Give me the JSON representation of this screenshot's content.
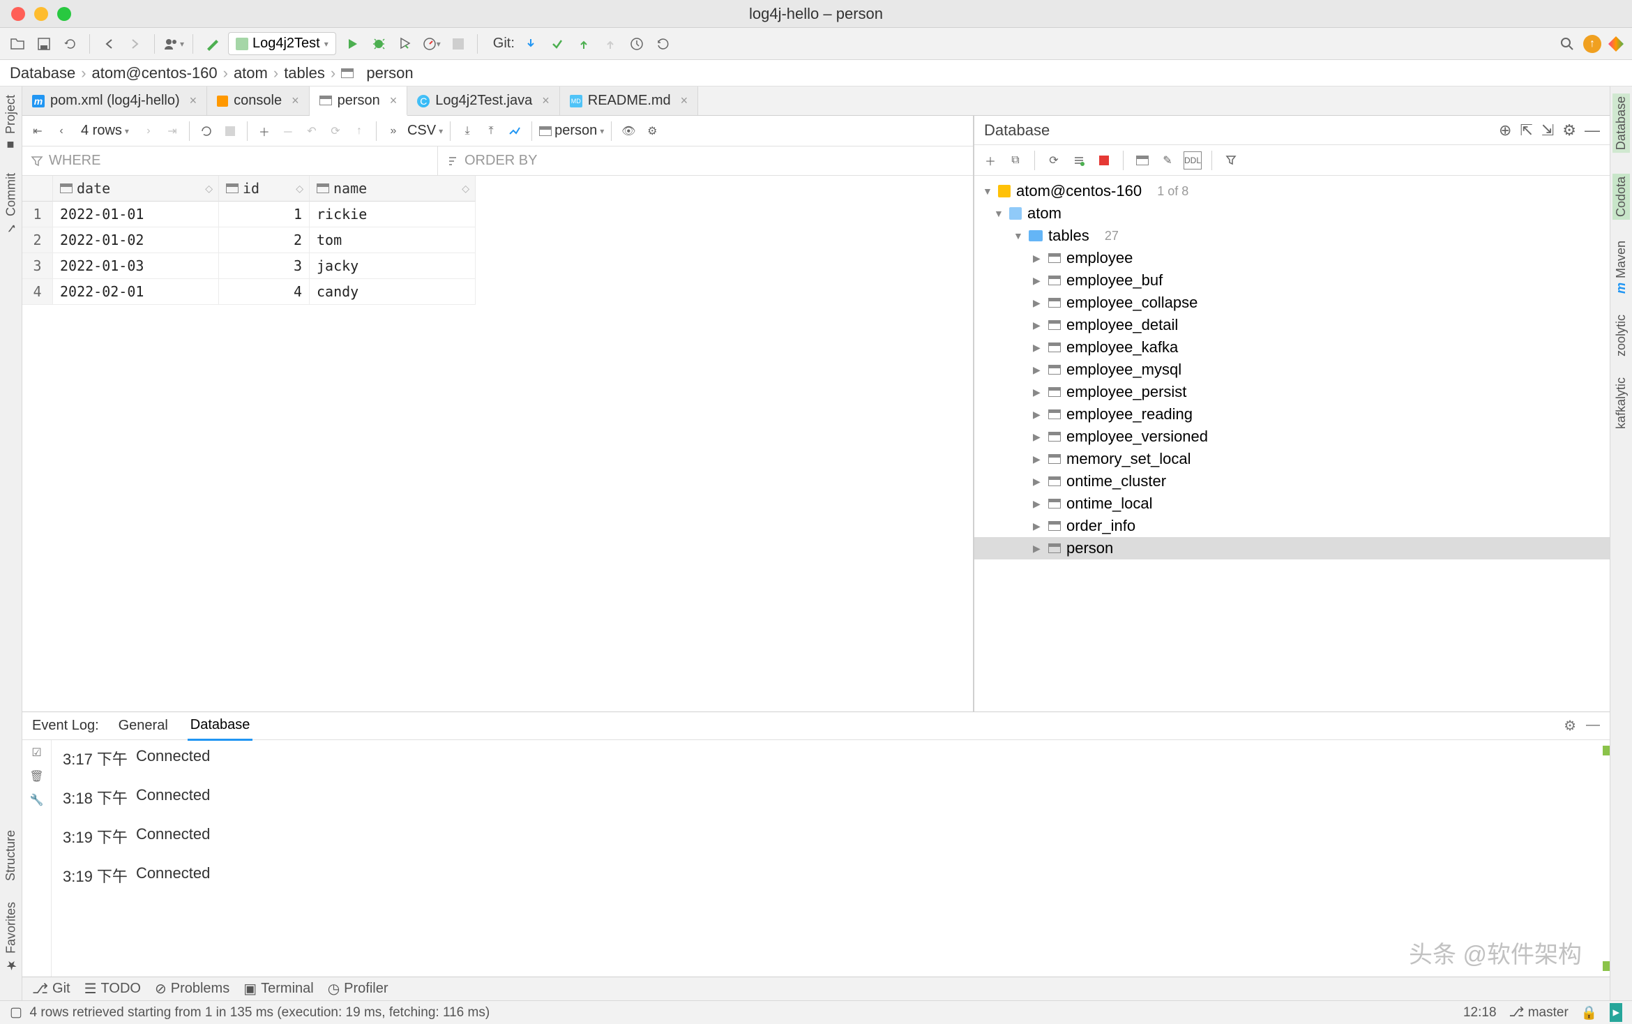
{
  "window": {
    "title": "log4j-hello – person"
  },
  "toolbar": {
    "run_config": "Log4j2Test",
    "git_label": "Git:"
  },
  "breadcrumb": [
    "Database",
    "atom@centos-160",
    "atom",
    "tables",
    "person"
  ],
  "tabs": [
    {
      "label": "pom.xml (log4j-hello)",
      "icon": "pom",
      "active": false
    },
    {
      "label": "console",
      "icon": "console",
      "active": false
    },
    {
      "label": "person",
      "icon": "table",
      "active": true
    },
    {
      "label": "Log4j2Test.java",
      "icon": "java",
      "active": false
    },
    {
      "label": "README.md",
      "icon": "md",
      "active": false
    }
  ],
  "grid_toolbar": {
    "row_count": "4 rows",
    "export_format": "CSV",
    "table_selector": "person"
  },
  "filters": {
    "where": "WHERE",
    "orderby": "ORDER BY"
  },
  "grid": {
    "columns": [
      "date",
      "id",
      "name"
    ],
    "rows": [
      {
        "n": "1",
        "date": "2022-01-01",
        "id": "1",
        "name": "rickie"
      },
      {
        "n": "2",
        "date": "2022-01-02",
        "id": "2",
        "name": "tom"
      },
      {
        "n": "3",
        "date": "2022-01-03",
        "id": "3",
        "name": "jacky"
      },
      {
        "n": "4",
        "date": "2022-02-01",
        "id": "4",
        "name": "candy"
      }
    ]
  },
  "db_panel": {
    "title": "Database",
    "datasource": "atom@centos-160",
    "ds_count": "1 of 8",
    "schema": "atom",
    "tables_label": "tables",
    "tables_count": "27",
    "tables": [
      "employee",
      "employee_buf",
      "employee_collapse",
      "employee_detail",
      "employee_kafka",
      "employee_mysql",
      "employee_persist",
      "employee_reading",
      "employee_versioned",
      "memory_set_local",
      "ontime_cluster",
      "ontime_local",
      "order_info",
      "person"
    ],
    "selected_table": "person"
  },
  "left_gutter": [
    "Project",
    "Commit"
  ],
  "right_gutter": [
    "Database",
    "Codota",
    "Maven",
    "zoolytic",
    "kafkalytic"
  ],
  "event_log": {
    "label": "Event Log:",
    "tabs": [
      "General",
      "Database"
    ],
    "active_tab": "Database",
    "entries": [
      {
        "time": "3:17 下午",
        "msg": "Connected"
      },
      {
        "time": "3:18 下午",
        "msg": "Connected"
      },
      {
        "time": "3:19 下午",
        "msg": "Connected"
      },
      {
        "time": "3:19 下午",
        "msg": "Connected"
      }
    ]
  },
  "bottom_tool": [
    "Git",
    "TODO",
    "Problems",
    "Terminal",
    "Profiler"
  ],
  "left_bottom_gutter": [
    "Structure",
    "Favorites"
  ],
  "status": {
    "message": "4 rows retrieved starting from 1 in 135 ms (execution: 19 ms, fetching: 116 ms)",
    "clock": "12:18",
    "branch": "master"
  },
  "watermark": "头条 @软件架构"
}
